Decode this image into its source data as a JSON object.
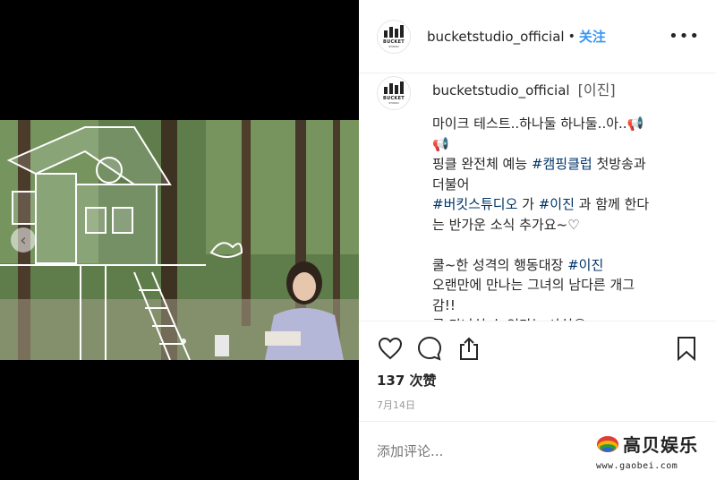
{
  "post": {
    "username": "bucketstudio_official",
    "follow_separator": "•",
    "follow_label": "关注",
    "more_label": "•••",
    "logo_text": "BUCKET",
    "logo_sub": "STUDIO"
  },
  "caption": {
    "username": "bucketstudio_official",
    "tag": "[이진]",
    "lines": [
      {
        "text": "마이크 테스트..하나둘 하나둘..아..📢"
      },
      {
        "text": "📢"
      },
      {
        "pre": "핑클 완전체 예능 ",
        "tag": "#캠핑클럽",
        "post": " 첫방송과"
      },
      {
        "text": "더불어"
      },
      {
        "pre": "",
        "tag": "#버킷스튜디오",
        "post": " 가 ",
        "tag2": "#이진",
        "post2": " 과 함께 한다"
      },
      {
        "text": "는 반가운 소식 추가요~♡"
      },
      {
        "text": " "
      },
      {
        "pre": "쿨~한 성격의 행동대장 ",
        "tag": "#이진",
        "post": ""
      },
      {
        "text": "오랜만에 만나는 그녀의 남다른 개그"
      },
      {
        "text": "감!!"
      },
      {
        "text": "곧 만나실 수 있다는 사실😘"
      }
    ]
  },
  "actions": {
    "like_icon": "heart-icon",
    "comment_icon": "comment-icon",
    "share_icon": "share-icon",
    "save_icon": "bookmark-icon"
  },
  "likes": "137 次赞",
  "date": "7月14日",
  "comment": {
    "placeholder": "添加评论..."
  },
  "watermark": {
    "title": "高贝娱乐",
    "url": "www.gaobei.com"
  },
  "media": {
    "prev_icon": "chevron-left-icon"
  }
}
